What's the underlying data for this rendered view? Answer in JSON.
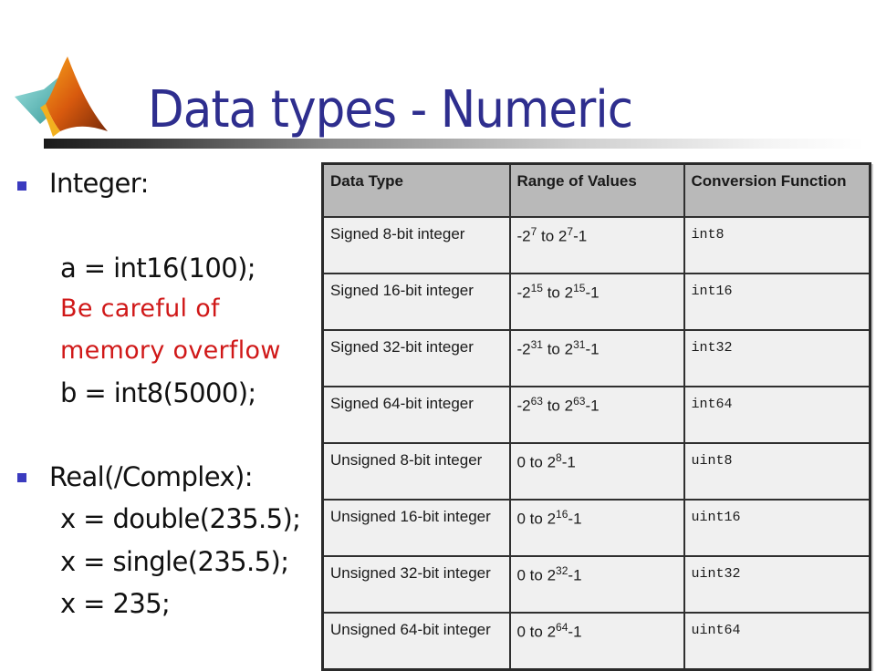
{
  "slide": {
    "title": "Data types - Numeric",
    "logo_icon": "matlab-membrane-logo"
  },
  "content": {
    "sections": [
      {
        "heading": "Integer:",
        "lines": [
          {
            "text": "a = int16(100);",
            "style": "code"
          },
          {
            "text": "Be careful of",
            "style": "warning"
          },
          {
            "text": "memory overflow",
            "style": "warning"
          },
          {
            "text": "b = int8(5000);",
            "style": "code"
          }
        ]
      },
      {
        "heading": "Real(/Complex):",
        "lines": [
          {
            "text": "x = double(235.5);",
            "style": "code"
          },
          {
            "text": "x = single(235.5);",
            "style": "code"
          },
          {
            "text": "x = 235;",
            "style": "code"
          }
        ]
      }
    ]
  },
  "table": {
    "headers": [
      "Data Type",
      "Range of Values",
      "Conversion Function"
    ],
    "rows": [
      {
        "type": "Signed 8-bit integer",
        "lo_prefix": "-2",
        "lo_exp": "7",
        "mid": " to 2",
        "hi_exp": "7",
        "suffix": "-1",
        "fn": "int8"
      },
      {
        "type": "Signed 16-bit integer",
        "lo_prefix": "-2",
        "lo_exp": "15",
        "mid": " to 2",
        "hi_exp": "15",
        "suffix": "-1",
        "fn": "int16"
      },
      {
        "type": "Signed 32-bit integer",
        "lo_prefix": "-2",
        "lo_exp": "31",
        "mid": " to 2",
        "hi_exp": "31",
        "suffix": "-1",
        "fn": "int32"
      },
      {
        "type": "Signed 64-bit integer",
        "lo_prefix": "-2",
        "lo_exp": "63",
        "mid": " to 2",
        "hi_exp": "63",
        "suffix": "-1",
        "fn": "int64"
      },
      {
        "type": "Unsigned 8-bit integer",
        "lo_prefix": "0 to 2",
        "lo_exp": "",
        "mid": "",
        "hi_exp": "8",
        "suffix": "-1",
        "fn": "uint8"
      },
      {
        "type": "Unsigned 16-bit integer",
        "lo_prefix": "0 to 2",
        "lo_exp": "",
        "mid": "",
        "hi_exp": "16",
        "suffix": "-1",
        "fn": "uint16"
      },
      {
        "type": "Unsigned 32-bit integer",
        "lo_prefix": "0 to 2",
        "lo_exp": "",
        "mid": "",
        "hi_exp": "32",
        "suffix": "-1",
        "fn": "uint32"
      },
      {
        "type": "Unsigned 64-bit integer",
        "lo_prefix": "0 to 2",
        "lo_exp": "",
        "mid": "",
        "hi_exp": "64",
        "suffix": "-1",
        "fn": "uint64"
      }
    ]
  },
  "colors": {
    "title": "#2e2e8e",
    "bullet": "#3b3bbf",
    "warning": "#d01818",
    "table_header_bg": "#b9b9b9",
    "table_cell_bg": "#f0f0f0"
  }
}
